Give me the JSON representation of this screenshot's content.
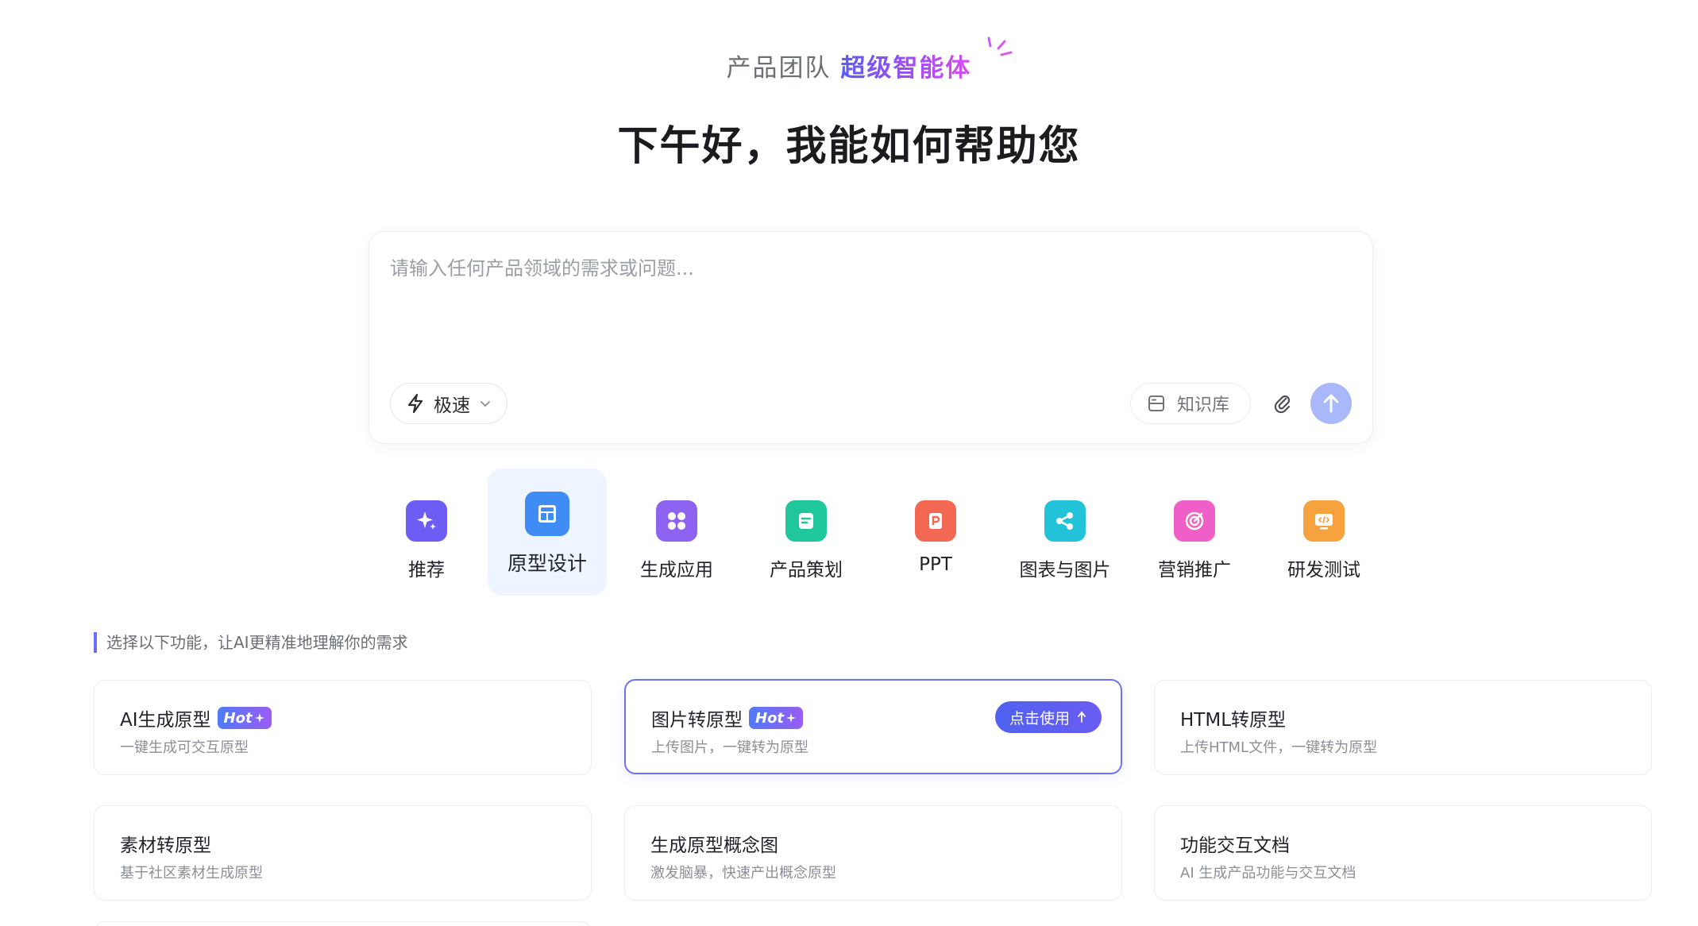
{
  "header": {
    "tag_prefix": "产品团队",
    "tag_highlight": "超级智能体",
    "greeting": "下午好，我能如何帮助您"
  },
  "input": {
    "placeholder": "请输入任何产品领域的需求或问题...",
    "mode_label": "极速",
    "knowledge_label": "知识库"
  },
  "categories": [
    {
      "label": "推荐",
      "icon": "sparkle-icon",
      "color": "#6d5df5"
    },
    {
      "label": "原型设计",
      "icon": "layout-icon",
      "color": "#3f8cf4",
      "active": true
    },
    {
      "label": "生成应用",
      "icon": "apps-icon",
      "color": "#8e63f2"
    },
    {
      "label": "产品策划",
      "icon": "document-icon",
      "color": "#1fc79a"
    },
    {
      "label": "PPT",
      "icon": "ppt-icon",
      "color": "#f36852"
    },
    {
      "label": "图表与图片",
      "icon": "share-icon",
      "color": "#22c2d8"
    },
    {
      "label": "营销推广",
      "icon": "target-icon",
      "color": "#f05fc8"
    },
    {
      "label": "研发测试",
      "icon": "code-icon",
      "color": "#f5a23f"
    }
  ],
  "hint": "选择以下功能，让AI更精准地理解你的需求",
  "cards": [
    {
      "title": "AI生成原型",
      "hot": "Hot",
      "desc": "一键生成可交互原型"
    },
    {
      "title": "图片转原型",
      "hot": "Hot",
      "desc": "上传图片，一键转为原型",
      "active": true,
      "action": "点击使用"
    },
    {
      "title": "HTML转原型",
      "desc": "上传HTML文件，一键转为原型"
    },
    {
      "title": "素材转原型",
      "desc": "基于社区素材生成原型"
    },
    {
      "title": "生成原型概念图",
      "desc": "激发脑暴，快速产出概念原型"
    },
    {
      "title": "功能交互文档",
      "desc": "AI 生成产品功能与交互文档"
    }
  ]
}
